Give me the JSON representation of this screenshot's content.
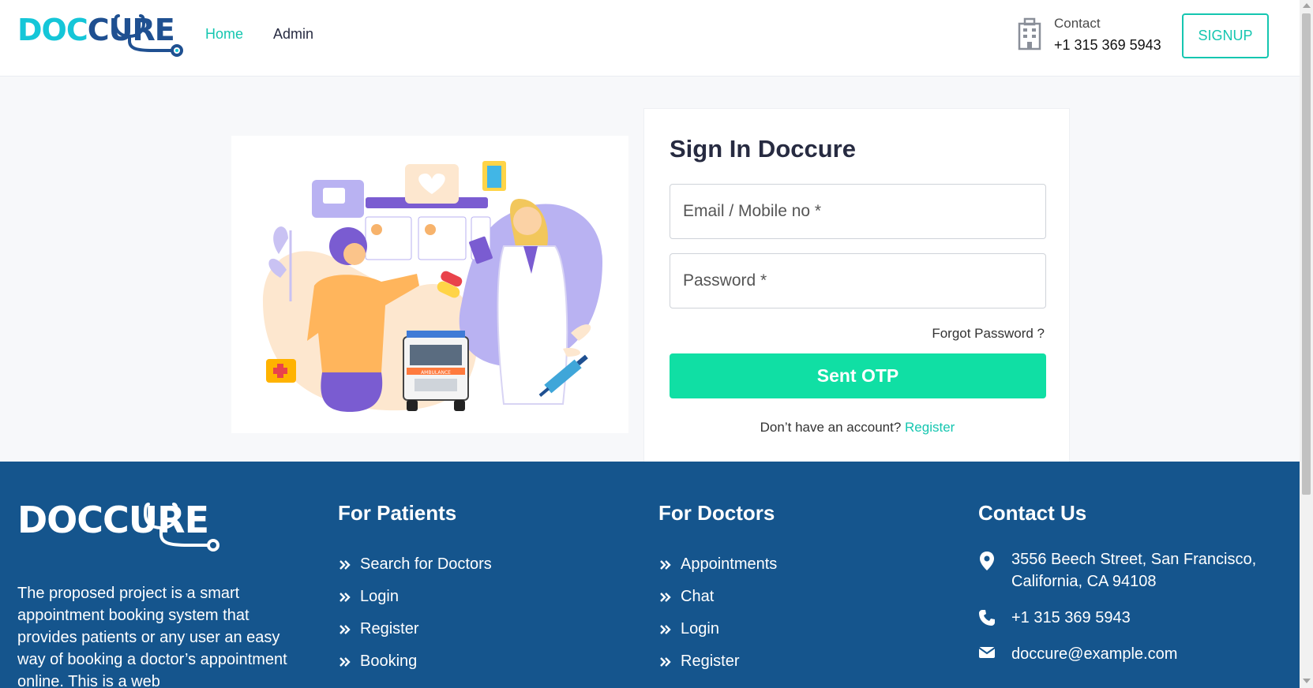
{
  "header": {
    "logo": {
      "part1": "DOC",
      "part2": "CURE"
    },
    "nav": [
      {
        "label": "Home",
        "active": true
      },
      {
        "label": "Admin",
        "active": false
      }
    ],
    "contact": {
      "label": "Contact",
      "phone": "+1 315 369 5943"
    },
    "signup_label": "SIGNUP"
  },
  "signin": {
    "title": "Sign In Doccure",
    "email_placeholder": "Email / Mobile no *",
    "password_placeholder": "Password *",
    "forgot_label": "Forgot Password ?",
    "submit_label": "Sent OTP",
    "no_account_text": "Don’t have an account?",
    "register_label": "Register"
  },
  "illustration": {
    "ambulance_label": "AMBULANCE"
  },
  "footer": {
    "logo": {
      "part1": "DOC",
      "part2": "CURE"
    },
    "description": "The proposed project is a smart appointment booking system that provides patients or any user an easy way of booking a doctor’s appointment online. This is a web",
    "patients": {
      "title": "For Patients",
      "links": [
        "Search for Doctors",
        "Login",
        "Register",
        "Booking"
      ]
    },
    "doctors": {
      "title": "For Doctors",
      "links": [
        "Appointments",
        "Chat",
        "Login",
        "Register"
      ]
    },
    "contact": {
      "title": "Contact Us",
      "address": "3556 Beech Street, San Francisco, California, CA 94108",
      "phone": "+1 315 369 5943",
      "email": "doccure@example.com"
    }
  },
  "colors": {
    "accent": "#15c6b0",
    "otp_button": "#10dfa4",
    "footer_bg": "#15558d",
    "logo_cyan": "#15c6d8",
    "logo_navy": "#1f5091"
  },
  "icons": [
    "building-icon",
    "stethoscope-icon",
    "chevrons-right-icon",
    "location-pin-icon",
    "phone-icon",
    "mail-icon"
  ]
}
